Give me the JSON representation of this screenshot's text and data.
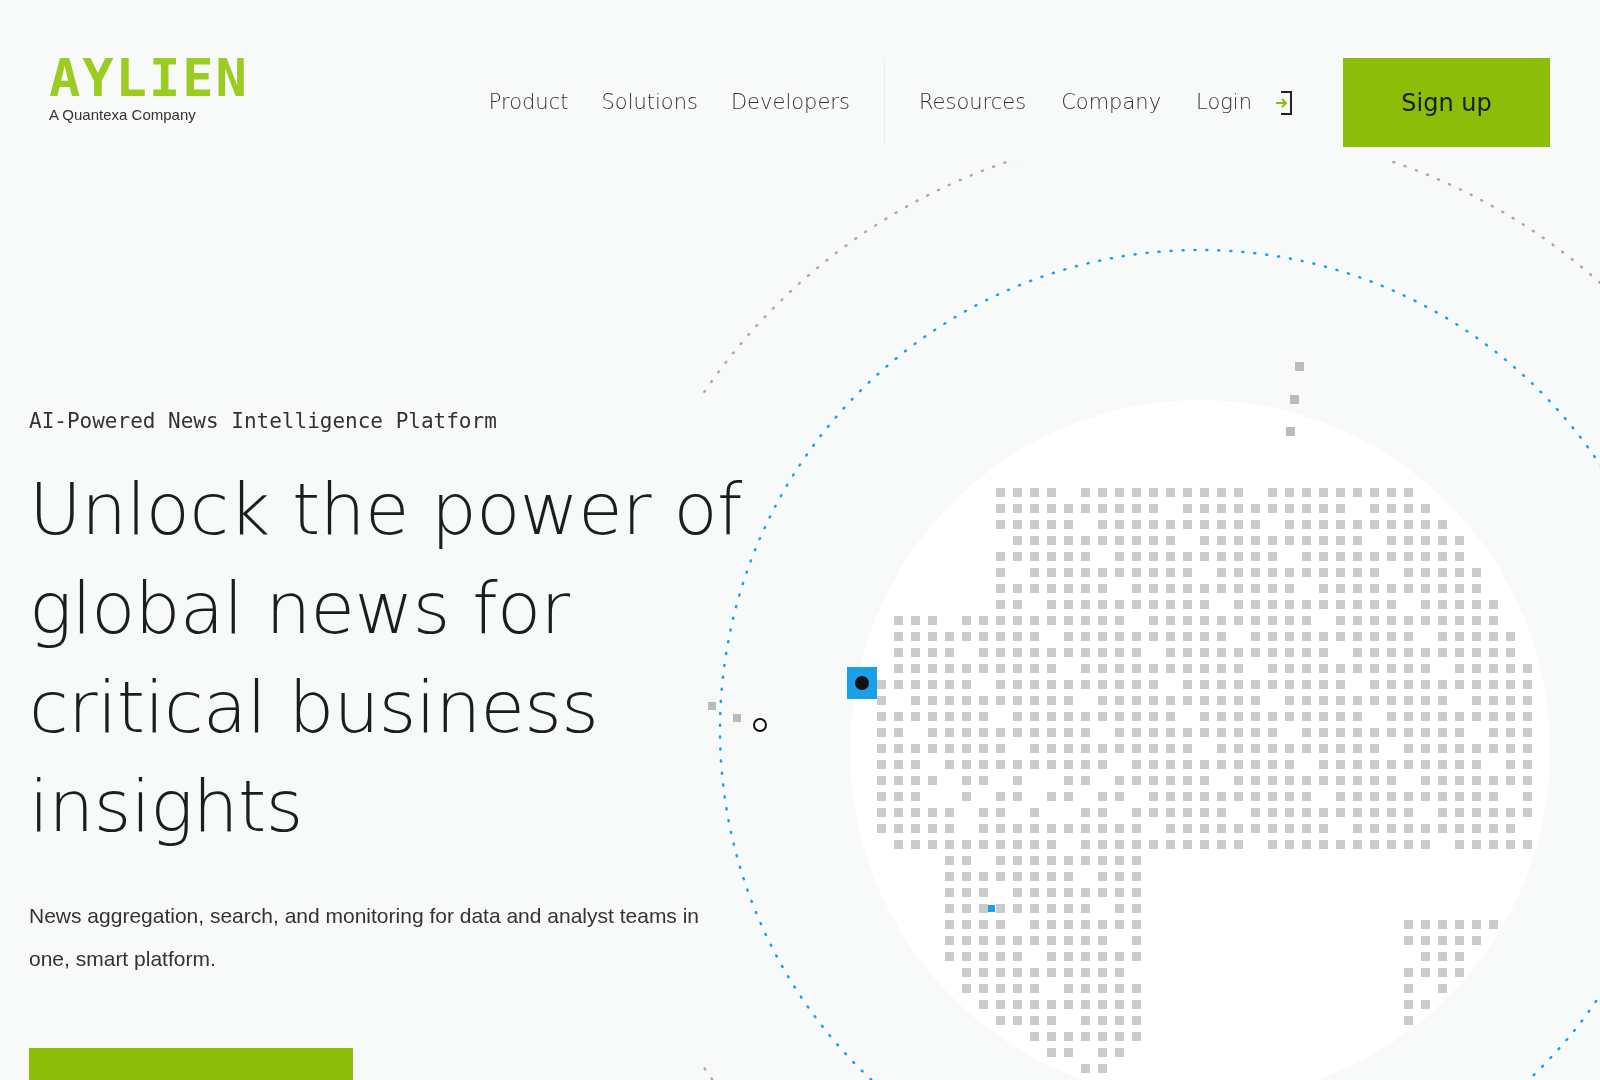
{
  "logo": {
    "wordmark": "AYLIEN",
    "tagline": "A Quantexa Company"
  },
  "nav": {
    "primary": [
      "Product",
      "Solutions",
      "Developers"
    ],
    "secondary": [
      "Resources",
      "Company",
      "Login"
    ],
    "signup": "Sign up"
  },
  "hero": {
    "eyebrow": "AI-Powered News Intelligence Platform",
    "headline": [
      "Unlock the power of",
      "global news for",
      "critical business",
      "insights"
    ],
    "description": "News aggregation, search, and monitoring for data and analyst teams in one, smart platform."
  }
}
